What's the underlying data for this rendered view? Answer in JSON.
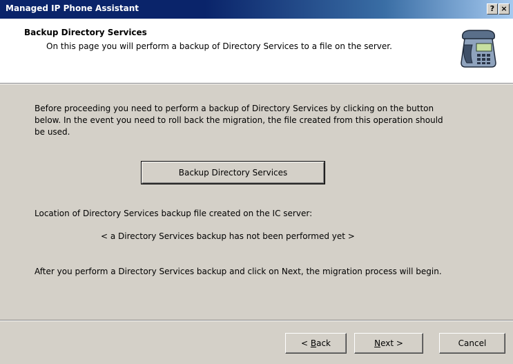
{
  "window": {
    "title": "Managed IP Phone Assistant",
    "help_glyph": "?",
    "close_glyph": "×"
  },
  "header": {
    "title": "Backup Directory Services",
    "subtitle": "On this page you will perform a backup of Directory Services to a file on the server.",
    "icon": "telephone-icon"
  },
  "body": {
    "intro": "Before proceeding you need to perform a backup of Directory Services by clicking on the button below.  In the event you need to roll back the migration, the file created from this operation should be used.",
    "backup_button_label": "Backup Directory Services",
    "location_label": "Location of Directory Services backup file created on the IC server:",
    "location_status": "< a Directory Services backup has not been performed yet >",
    "after_text": "After you perform a Directory Services backup and click on Next, the migration process will begin."
  },
  "footer": {
    "back_prefix": "< ",
    "back_accel": "B",
    "back_rest": "ack",
    "next_accel": "N",
    "next_rest": "ext >",
    "cancel_label": "Cancel"
  },
  "colors": {
    "titlebar_start": "#0a246a",
    "titlebar_end": "#a6caf0",
    "dialog_bg": "#d4d0c8",
    "header_bg": "#ffffff"
  }
}
